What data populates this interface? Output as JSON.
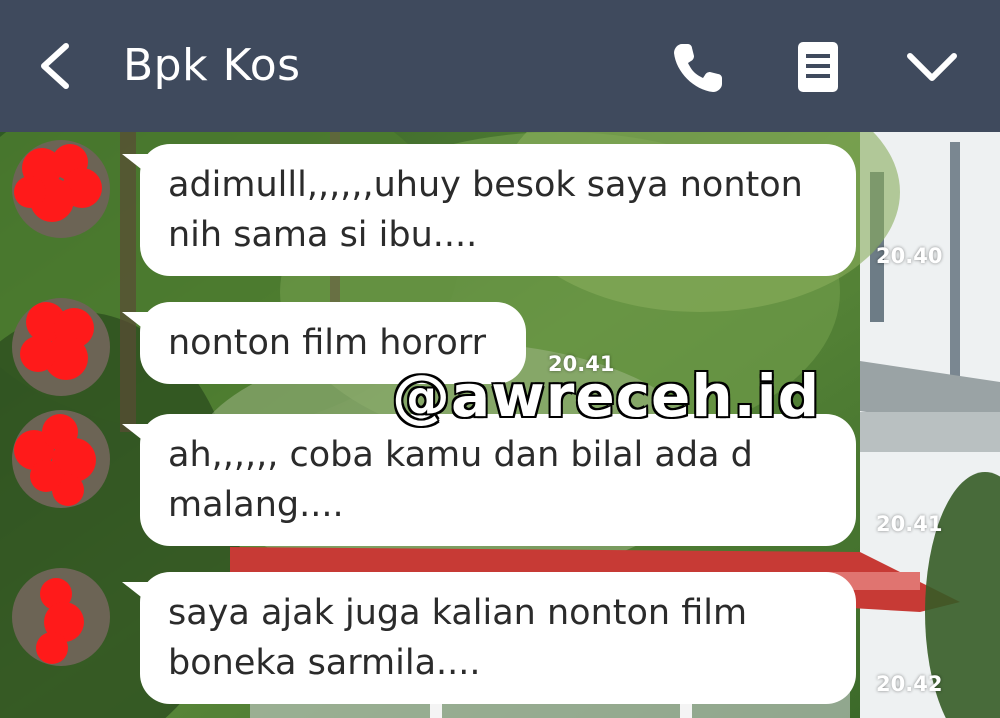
{
  "header": {
    "title": "Bpk Kos",
    "back_icon": "chevron-left-icon",
    "call_icon": "phone-icon",
    "notes_icon": "notes-icon",
    "menu_icon": "chevron-down-icon",
    "background_color": "#3f4a5d"
  },
  "messages": [
    {
      "text": "adimulll,,,,,,uhuy besok saya nonton\nnih sama si ibu....",
      "time": "20.40"
    },
    {
      "text": "nonton film hororr",
      "time": "20.41"
    },
    {
      "text": "ah,,,,,, coba kamu dan bilal ada d\nmalang....",
      "time": "20.41"
    },
    {
      "text": "saya ajak juga kalian nonton film\nboneka sarmila....",
      "time": "20.42"
    }
  ],
  "watermark": "@awreceh.id"
}
